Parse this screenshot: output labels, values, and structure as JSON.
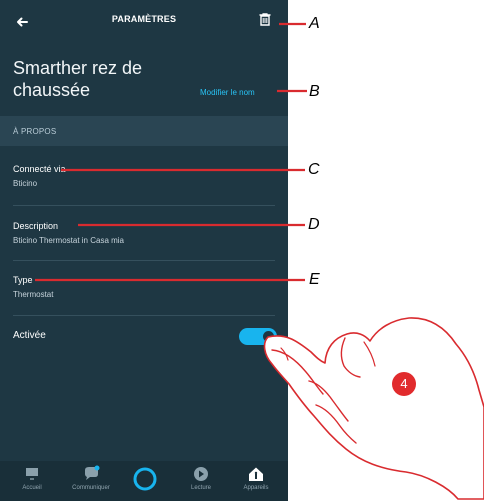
{
  "header": {
    "title": "PARAMÈTRES",
    "back_icon": "arrow-left-icon",
    "delete_icon": "trash-icon"
  },
  "device": {
    "name": "Smarther rez de\nchaussée",
    "rename_label": "Modifier le nom"
  },
  "about": {
    "section_label": "À PROPOS",
    "items": [
      {
        "label": "Connecté via",
        "value": "Bticino"
      },
      {
        "label": "Description",
        "value": "Bticino Thermostat in Casa mia"
      },
      {
        "label": "Type",
        "value": "Thermostat"
      }
    ]
  },
  "enabled": {
    "label": "Activée",
    "state": true
  },
  "bottom_nav": {
    "items": [
      {
        "label": "Accueil",
        "icon": "home-icon"
      },
      {
        "label": "Communiquer",
        "icon": "chat-icon"
      },
      {
        "label": "",
        "icon": "alexa-icon"
      },
      {
        "label": "Lecture",
        "icon": "play-icon"
      },
      {
        "label": "Appareils",
        "icon": "smart-home-icon"
      }
    ]
  },
  "callouts": [
    "A",
    "B",
    "C",
    "D",
    "E"
  ],
  "step": "4",
  "colors": {
    "background": "#1e3743",
    "accent": "#18b4ee",
    "link": "#28c2f4",
    "callout_line": "#d92b2f",
    "step_badge": "#e12b2d"
  }
}
